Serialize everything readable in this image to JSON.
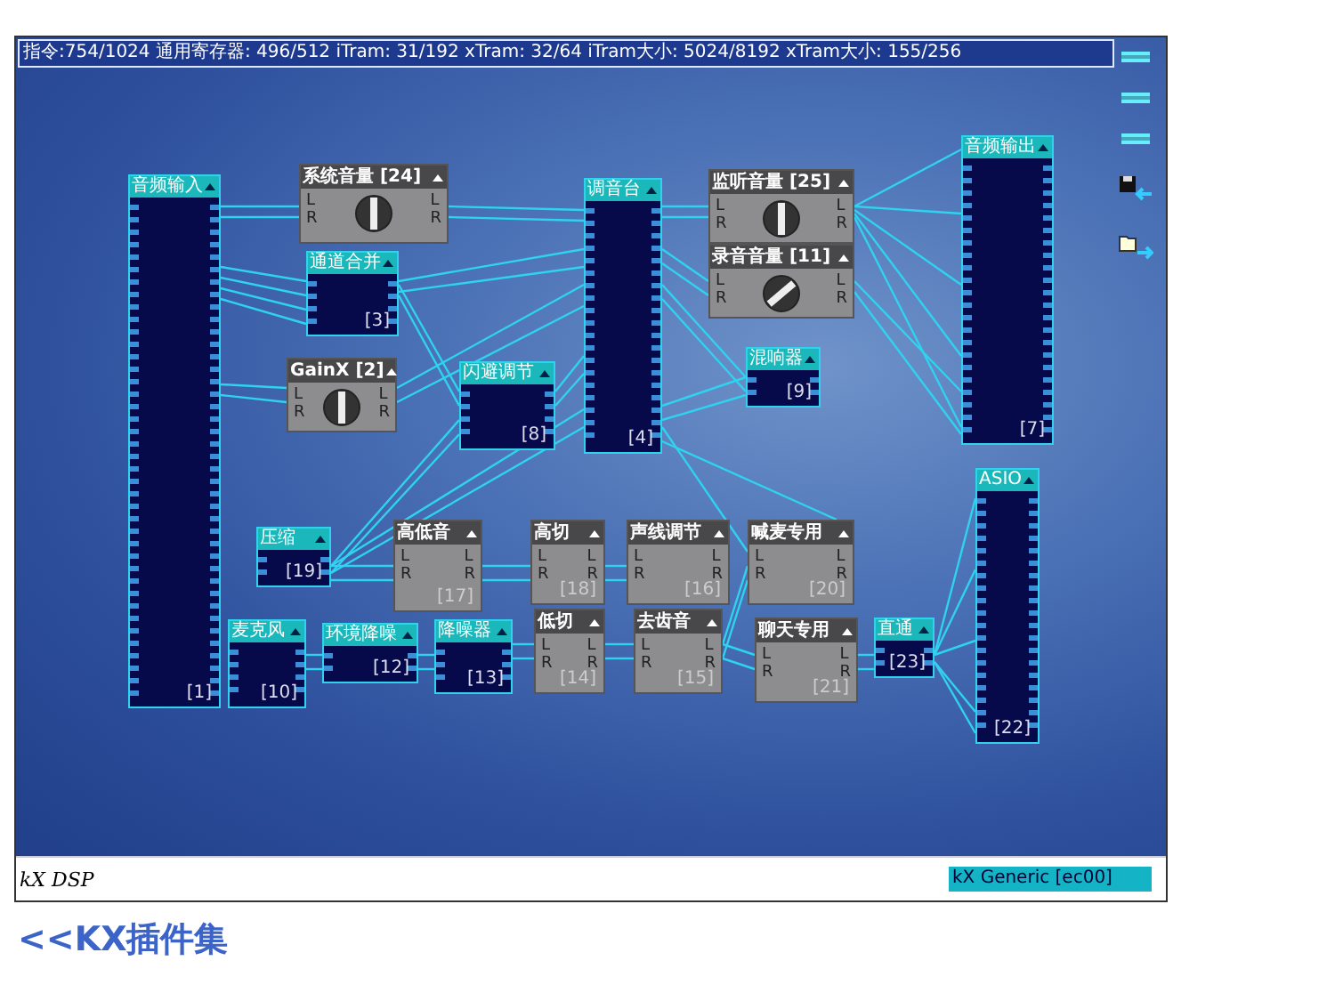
{
  "status_bar": {
    "text": "指令:754/1024 通用寄存器: 496/512 iTram: 31/192 xTram: 32/64 iTram大小: 5024/8192 xTram大小: 155/256"
  },
  "nodes": [
    {
      "kind": "bus",
      "title": "音频输入",
      "number": "[1]"
    },
    {
      "kind": "gain",
      "title": "系统音量 [24]",
      "inputs": [
        "L",
        "R"
      ],
      "outputs": [
        "L",
        "R"
      ]
    },
    {
      "kind": "bus",
      "title": "通道合并",
      "number": "[3]"
    },
    {
      "kind": "gain",
      "title": "GainX [2]",
      "inputs": [
        "L",
        "R"
      ],
      "outputs": [
        "L",
        "R"
      ]
    },
    {
      "kind": "bus",
      "title": "闪避调节",
      "number": "[8]"
    },
    {
      "kind": "bus",
      "title": "调音台",
      "number": "[4]"
    },
    {
      "kind": "gain",
      "title": "监听音量 [25]",
      "inputs": [
        "L",
        "R"
      ],
      "outputs": [
        "L",
        "R"
      ]
    },
    {
      "kind": "gain",
      "title": "录音音量 [11]",
      "inputs": [
        "L",
        "R"
      ],
      "outputs": [
        "L",
        "R"
      ]
    },
    {
      "kind": "bus",
      "title": "混响器",
      "number": "[9]"
    },
    {
      "kind": "bus",
      "title": "音频输出",
      "number": "[7]"
    },
    {
      "kind": "bus",
      "title": "压缩",
      "number": "[19]"
    },
    {
      "kind": "effect",
      "title": "高低音",
      "number": "[17]",
      "inputs": [
        "L",
        "R"
      ],
      "outputs": [
        "L",
        "R"
      ]
    },
    {
      "kind": "effect",
      "title": "高切",
      "number": "[18]",
      "inputs": [
        "L",
        "R"
      ],
      "outputs": [
        "L",
        "R"
      ]
    },
    {
      "kind": "effect",
      "title": "声线调节",
      "number": "[16]",
      "inputs": [
        "L",
        "R"
      ],
      "outputs": [
        "L",
        "R"
      ]
    },
    {
      "kind": "effect",
      "title": "喊麦专用",
      "number": "[20]",
      "inputs": [
        "L",
        "R"
      ],
      "outputs": [
        "L",
        "R"
      ]
    },
    {
      "kind": "bus",
      "title": "麦克风",
      "number": "[10]"
    },
    {
      "kind": "bus",
      "title": "环境降噪",
      "number": "[12]"
    },
    {
      "kind": "bus",
      "title": "降噪器",
      "number": "[13]"
    },
    {
      "kind": "effect",
      "title": "低切",
      "number": "[14]",
      "inputs": [
        "L",
        "R"
      ],
      "outputs": [
        "L",
        "R"
      ]
    },
    {
      "kind": "effect",
      "title": "去齿音",
      "number": "[15]",
      "inputs": [
        "L",
        "R"
      ],
      "outputs": [
        "L",
        "R"
      ]
    },
    {
      "kind": "effect",
      "title": "聊天专用",
      "number": "[21]",
      "inputs": [
        "L",
        "R"
      ],
      "outputs": [
        "L",
        "R"
      ]
    },
    {
      "kind": "bus",
      "title": "直通",
      "number": "[23]"
    },
    {
      "kind": "bus",
      "title": "ASIO",
      "number": "[22]"
    }
  ],
  "footer": {
    "brand": "kX DSP",
    "device": "kX Generic [ec00]"
  },
  "link": "<<KX插件集"
}
